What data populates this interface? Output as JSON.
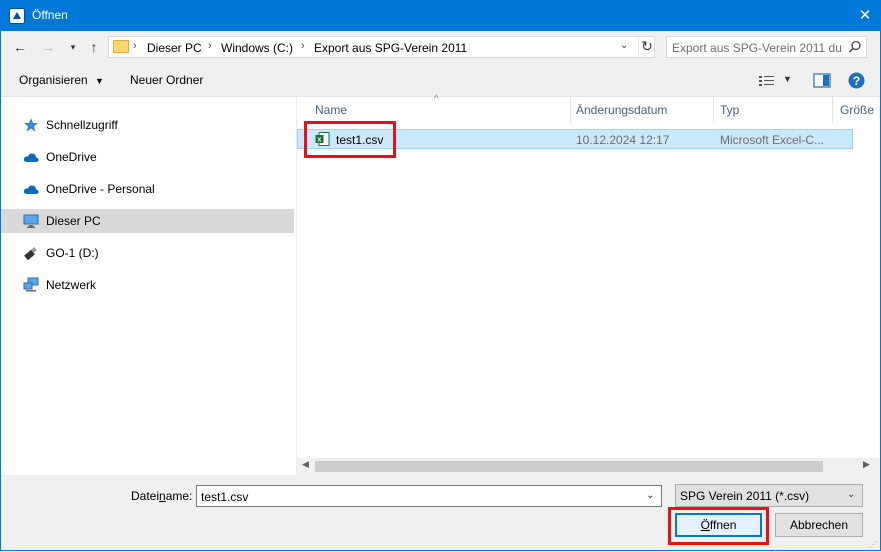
{
  "window": {
    "title": "Öffnen",
    "close_glyph": "✕"
  },
  "address": {
    "crumbs": [
      "Dieser PC",
      "Windows (C:)",
      "Export aus SPG-Verein 2011"
    ],
    "separator": "›"
  },
  "search": {
    "placeholder": "Export aus SPG-Verein 2011 du..."
  },
  "toolbar": {
    "organize": "Organisieren",
    "new_folder": "Neuer Ordner"
  },
  "nav": {
    "items": [
      {
        "label": "Schnellzugriff",
        "icon": "star-icon"
      },
      {
        "label": "OneDrive",
        "icon": "cloud-icon"
      },
      {
        "label": "OneDrive - Personal",
        "icon": "cloud-icon"
      },
      {
        "label": "Dieser PC",
        "icon": "computer-icon",
        "selected": true
      },
      {
        "label": "GO-1 (D:)",
        "icon": "usb-drive-icon"
      },
      {
        "label": "Netzwerk",
        "icon": "network-icon"
      }
    ]
  },
  "files": {
    "columns": {
      "name": "Name",
      "date": "Änderungsdatum",
      "type": "Typ",
      "size": "Größe"
    },
    "rows": [
      {
        "name": "test1.csv",
        "date": "10.12.2024 12:17",
        "type": "Microsoft Excel-C..."
      }
    ]
  },
  "bottom": {
    "filename_label_pre": "Datei",
    "filename_label_ul": "n",
    "filename_label_post": "ame:",
    "filename_value": "test1.csv",
    "filter_value": "SPG Verein 2011 (*.csv)",
    "open_label_pre": "Ö",
    "open_label_post": "ffnen",
    "cancel_label": "Abbrechen"
  },
  "colors": {
    "accent": "#0078d7",
    "selection": "#cce8ff",
    "highlight": "#e8111a"
  }
}
